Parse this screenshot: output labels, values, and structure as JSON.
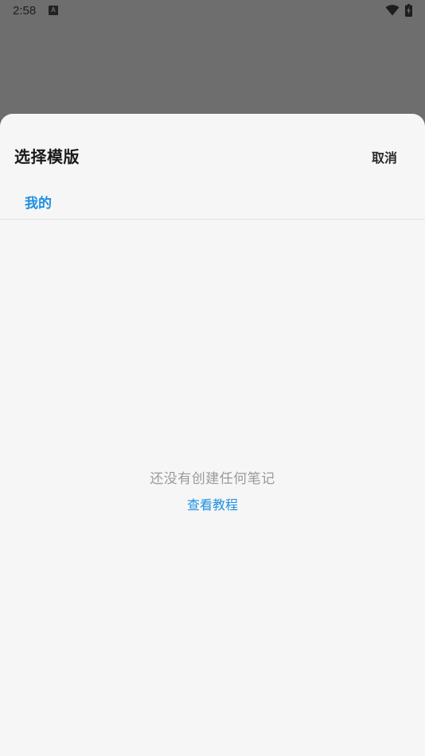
{
  "status_bar": {
    "time": "2:58",
    "notification_icon": "a-notification-icon",
    "notification_glyph": "A",
    "wifi_icon": "wifi-icon",
    "battery_icon": "battery-charging-icon"
  },
  "sheet": {
    "title": "选择模版",
    "cancel_label": "取消",
    "tabs": [
      {
        "label": "我的",
        "active": true
      }
    ],
    "empty_state": {
      "message": "还没有创建任何笔记",
      "link_label": "查看教程"
    }
  },
  "colors": {
    "scrim": "#6e6e6e",
    "sheet_background": "#f6f6f6",
    "accent": "#1e8fe1",
    "muted_text": "#9a9a9a"
  }
}
